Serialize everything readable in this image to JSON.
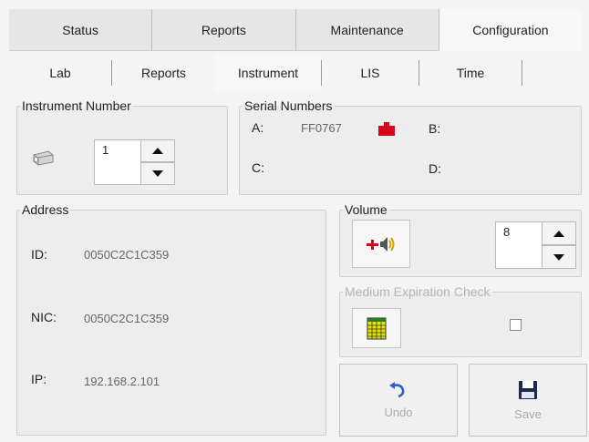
{
  "tabs_main": [
    {
      "label": "Status"
    },
    {
      "label": "Reports"
    },
    {
      "label": "Maintenance"
    },
    {
      "label": "Configuration"
    }
  ],
  "tabs_sub": [
    {
      "label": "Lab"
    },
    {
      "label": "Reports"
    },
    {
      "label": "Instrument"
    },
    {
      "label": "LIS"
    },
    {
      "label": "Time"
    }
  ],
  "instrument_number": {
    "legend": "Instrument Number",
    "value": "1"
  },
  "serial_numbers": {
    "legend": "Serial Numbers",
    "a_label": "A:",
    "a_value": "FF0767",
    "b_label": "B:",
    "b_value": "",
    "c_label": "C:",
    "c_value": "",
    "d_label": "D:",
    "d_value": ""
  },
  "address": {
    "legend": "Address",
    "id_label": "ID:",
    "id_value": "0050C2C1C359",
    "nic_label": "NIC:",
    "nic_value": "0050C2C1C359",
    "ip_label": "IP:",
    "ip_value": "192.168.2.101"
  },
  "volume": {
    "legend": "Volume",
    "value": "8"
  },
  "medium_expiration": {
    "legend": "Medium Expiration Check",
    "checked": false
  },
  "actions": {
    "undo_label": "Undo",
    "save_label": "Save"
  },
  "colors": {
    "accent_red": "#d9001b",
    "undo_blue": "#2f5fc7",
    "save_navy": "#1f2a4a"
  }
}
